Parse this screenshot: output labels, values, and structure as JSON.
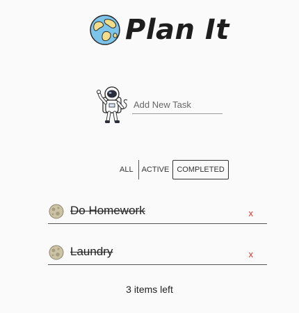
{
  "header": {
    "title": "Plan It",
    "logo_icon": "globe-icon"
  },
  "add_task": {
    "placeholder": "Add New Task",
    "value": "",
    "mascot_icon": "astronaut-icon"
  },
  "filters": [
    {
      "label": "ALL",
      "selected": false
    },
    {
      "label": "ACTIVE",
      "selected": false
    },
    {
      "label": "COMPLETED",
      "selected": true
    }
  ],
  "tasks": [
    {
      "text": "Do Homework",
      "completed": true,
      "icon": "moon-icon",
      "delete_label": "x"
    },
    {
      "text": "Laundry",
      "completed": true,
      "icon": "moon-icon",
      "delete_label": "x"
    }
  ],
  "footer": {
    "items_left": "3 items left"
  },
  "colors": {
    "delete": "#e0322b",
    "text": "#222222",
    "background": "#fafafa"
  }
}
